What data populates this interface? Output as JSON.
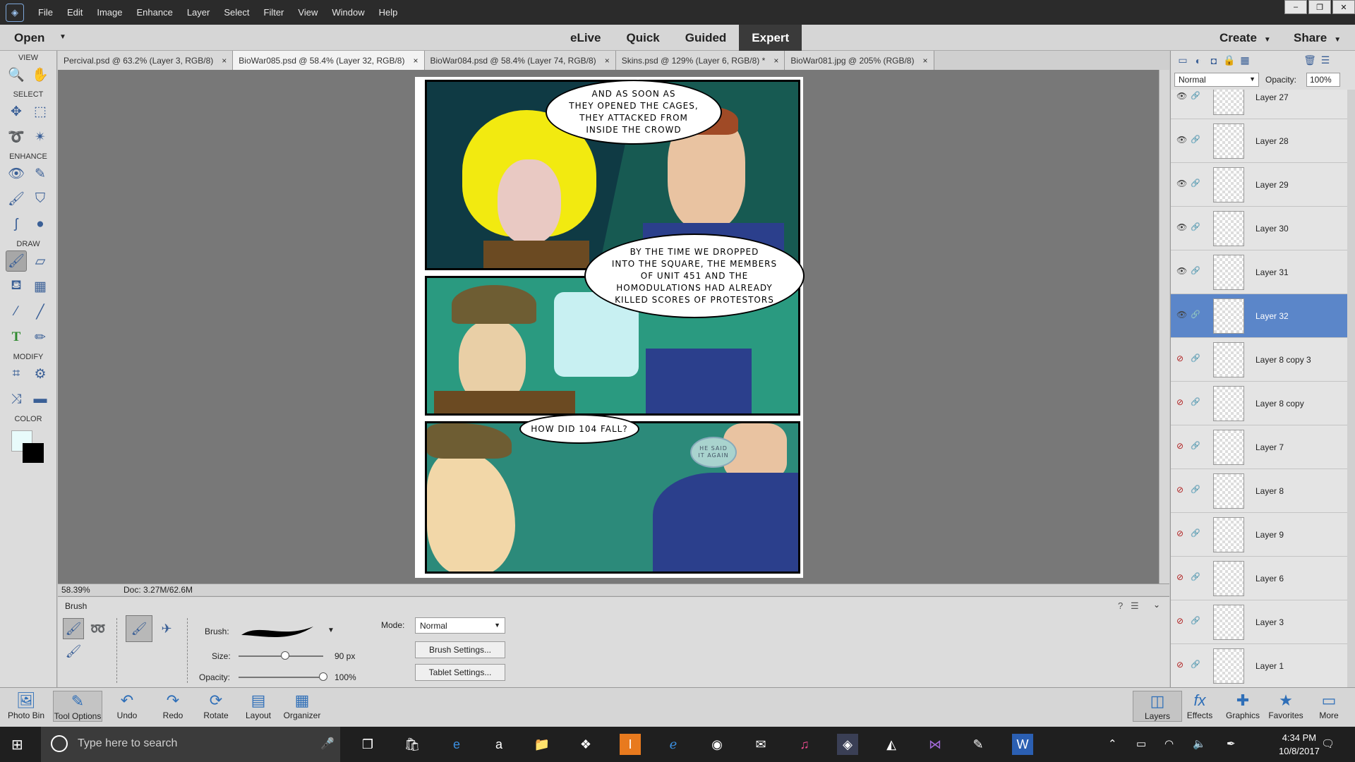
{
  "menubar": {
    "items": [
      "File",
      "Edit",
      "Image",
      "Enhance",
      "Layer",
      "Select",
      "Filter",
      "View",
      "Window",
      "Help"
    ],
    "window_controls": [
      "–",
      "❐",
      "✕"
    ]
  },
  "modebar": {
    "open": "Open",
    "tabs": [
      "eLive",
      "Quick",
      "Guided",
      "Expert"
    ],
    "active_tab": "Expert",
    "create": "Create",
    "share": "Share"
  },
  "toolbox": {
    "sections": [
      "VIEW",
      "SELECT",
      "ENHANCE",
      "DRAW",
      "MODIFY",
      "COLOR"
    ]
  },
  "doc_tabs": [
    {
      "label": "Percival.psd @ 63.2% (Layer 3, RGB/8)",
      "active": false
    },
    {
      "label": "BioWar085.psd @ 58.4% (Layer 32, RGB/8)",
      "active": true
    },
    {
      "label": "BioWar084.psd @ 58.4% (Layer 74, RGB/8)",
      "active": false
    },
    {
      "label": "Skins.psd @ 129% (Layer 6, RGB/8) *",
      "active": false
    },
    {
      "label": "BioWar081.jpg @ 205% (RGB/8)",
      "active": false
    }
  ],
  "status": {
    "zoom": "58.39%",
    "doc": "Doc: 3.27M/62.6M"
  },
  "comic": {
    "bubble1": "AND AS SOON AS\nTHEY OPENED THE CAGES,\nTHEY ATTACKED FROM\nINSIDE THE CROWD",
    "bubble2": "BY THE TIME WE DROPPED\nINTO THE SQUARE, THE MEMBERS\nOF UNIT 451 AND THE\nHOMODULATIONS HAD ALREADY\nKILLED SCORES OF PROTESTORS",
    "bubble3": "HOW DID 104 FALL?",
    "whisper": "HE SAID\nIT AGAIN"
  },
  "tool_options": {
    "title": "Brush",
    "brush_label": "Brush:",
    "size_label": "Size:",
    "size_value": "90 px",
    "size_fraction": 0.55,
    "opacity_label": "Opacity:",
    "opacity_value": "100%",
    "opacity_fraction": 1.0,
    "mode_label": "Mode:",
    "mode_value": "Normal",
    "brush_settings": "Brush Settings...",
    "tablet_settings": "Tablet Settings..."
  },
  "layers": {
    "blend_mode": "Normal",
    "opacity_label": "Opacity:",
    "opacity_value": "100%",
    "items": [
      {
        "name": "Layer 27",
        "visible": true,
        "selected": false
      },
      {
        "name": "Layer 28",
        "visible": true,
        "selected": false
      },
      {
        "name": "Layer 29",
        "visible": true,
        "selected": false
      },
      {
        "name": "Layer 30",
        "visible": true,
        "selected": false
      },
      {
        "name": "Layer 31",
        "visible": true,
        "selected": false
      },
      {
        "name": "Layer 32",
        "visible": true,
        "selected": true
      },
      {
        "name": "Layer 8 copy 3",
        "visible": false,
        "selected": false
      },
      {
        "name": "Layer 8 copy",
        "visible": false,
        "selected": false
      },
      {
        "name": "Layer 7",
        "visible": false,
        "selected": false
      },
      {
        "name": "Layer 8",
        "visible": false,
        "selected": false
      },
      {
        "name": "Layer 9",
        "visible": false,
        "selected": false
      },
      {
        "name": "Layer 6",
        "visible": false,
        "selected": false
      },
      {
        "name": "Layer 3",
        "visible": false,
        "selected": false
      },
      {
        "name": "Layer 1",
        "visible": false,
        "selected": false
      }
    ]
  },
  "bottom_bin": {
    "left": [
      "Photo Bin",
      "Tool Options",
      "Undo",
      "Redo",
      "Rotate",
      "Layout",
      "Organizer"
    ],
    "right": [
      "Layers",
      "Effects",
      "Graphics",
      "Favorites",
      "More"
    ]
  },
  "taskbar": {
    "search_placeholder": "Type here to search",
    "time": "4:34 PM",
    "date": "10/8/2017"
  },
  "colors": {
    "foreground": "#e8fbfb",
    "background": "#000000",
    "selected_layer": "#5b86c9"
  }
}
